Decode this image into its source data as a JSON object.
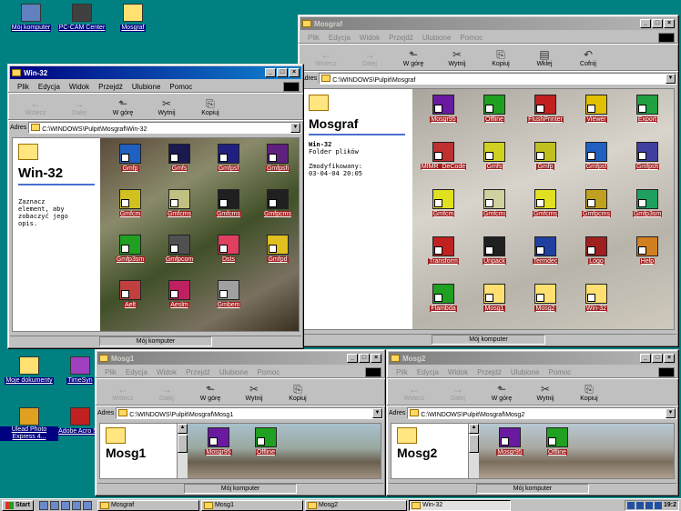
{
  "desktop": {
    "icons_top": [
      {
        "label": "Mój komputer"
      },
      {
        "label": "PC-CAM Center"
      },
      {
        "label": "Mosgraf"
      }
    ],
    "icons_bottom": [
      {
        "label": "Moje dokumenty"
      },
      {
        "label": "TimeSyn"
      },
      {
        "label": "Ulead Photo Express 4..."
      },
      {
        "label": "Adobe Acro 5.0"
      }
    ]
  },
  "menu": [
    "Plik",
    "Edycja",
    "Widok",
    "Przejdź",
    "Ulubione",
    "Pomoc"
  ],
  "toolbar_full": [
    {
      "label": "Wstecz",
      "glyph": "←",
      "dis": true
    },
    {
      "label": "Dalej",
      "glyph": "→",
      "dis": true
    },
    {
      "label": "W górę",
      "glyph": "⬑",
      "dis": false
    },
    {
      "label": "Wytnij",
      "glyph": "✂",
      "dis": false
    },
    {
      "label": "Kopiuj",
      "glyph": "⎘",
      "dis": false
    },
    {
      "label": "Wklej",
      "glyph": "▤",
      "dis": false
    },
    {
      "label": "Cofnij",
      "glyph": "↶",
      "dis": false
    }
  ],
  "address_label": "Adres",
  "status_label": "Mój komputer",
  "mosgraf": {
    "title": "Mosgraf",
    "address": "C:\\WINDOWS\\Pulpit\\Mosgraf",
    "heading": "Mosgraf",
    "info_name": "Win-32",
    "info_type": "Folder plików",
    "info_mod_label": "Zmodyfikowany:",
    "info_mod_date": "03-04-04 20:05",
    "items": [
      "Mosgr95",
      "Offline",
      "FlushPrinter",
      "Viewer",
      "Export",
      "MIMR_DeCode",
      "Gmfs",
      "Gmfp",
      "Gmfpsf",
      "Gmfpsfi",
      "Gmfcm",
      "Gmfcmi",
      "Gmfcms",
      "Gmfpcms",
      "Gmfp3sm",
      "Transform",
      "Unpack",
      "Termdec",
      "Logo",
      "Help",
      "Flambda",
      "Mosg1",
      "Mosg2",
      "Win-32"
    ],
    "colors": [
      "#6a1aa0",
      "#20a020",
      "#c02020",
      "#e0c000",
      "#20a040",
      "#c03030",
      "#d0d020",
      "#c0c020",
      "#2060c0",
      "#4040a0",
      "#e0e020",
      "#d0d0a0",
      "#e0e020",
      "#c0a020",
      "#20a060",
      "#c02020",
      "#202020",
      "#2040a0",
      "#a02020",
      "#d08020",
      "#20a020",
      "#ffe070",
      "#ffe070",
      "#ffe070"
    ]
  },
  "win32": {
    "title": "Win-32",
    "address": "C:\\WINDOWS\\Pulpit\\Mosgraf\\Win-32",
    "heading": "Win-32",
    "help": "Zaznacz element, aby zobaczyć jego opis.",
    "items": [
      "Gmfp",
      "Gmfs",
      "Gmfpsf",
      "Gmfpsfi",
      "Gmfcm",
      "Gmfcms",
      "Gmfcms",
      "Gmfpcms",
      "Gmfp3sm",
      "Gmfpcom",
      "Dsts",
      "Gmfpd",
      "Aelt",
      "Aeslm",
      "Gmbem"
    ],
    "colors": [
      "#2060c0",
      "#1a1a50",
      "#202080",
      "#602080",
      "#d0c020",
      "#c0c080",
      "#202020",
      "#202020",
      "#20a020",
      "#505050",
      "#e04060",
      "#e0c020",
      "#c04040",
      "#c02060",
      "#a0a0a0"
    ]
  },
  "mosg1": {
    "title": "Mosg1",
    "address": "C:\\WINDOWS\\Pulpit\\Mosgraf\\Mosg1",
    "heading": "Mosg1",
    "items": [
      "Mosgr95",
      "Offline"
    ]
  },
  "mosg2": {
    "title": "Mosg2",
    "address": "C:\\WINDOWS\\Pulpit\\Mosgraf\\Mosg2",
    "heading": "Mosg2",
    "items": [
      "Mosgr95",
      "Offline"
    ]
  },
  "taskbar": {
    "start": "Start",
    "tasks": [
      "Mosgraf",
      "Mosg1",
      "Mosg2",
      "Win-32"
    ],
    "clock": "19:2"
  }
}
